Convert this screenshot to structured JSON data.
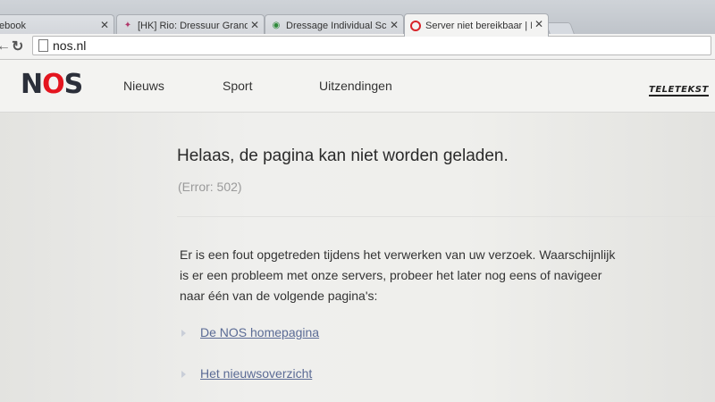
{
  "browser": {
    "tabs": [
      {
        "title": "ebook",
        "favicon": "facebook-icon",
        "active": false
      },
      {
        "title": "[HK] Rio: Dressuur Grand",
        "favicon": "rio-icon",
        "active": false
      },
      {
        "title": "Dressage Individual Sched",
        "favicon": "olympic-icon",
        "active": false
      },
      {
        "title": "Server niet bereikbaar | N",
        "favicon": "nos-icon",
        "active": true
      }
    ],
    "close_glyph": "✕",
    "address": "nos.nl"
  },
  "site": {
    "logo_prefix": "N",
    "logo_o": "O",
    "logo_suffix": "S",
    "nav": [
      "Nieuws",
      "Sport",
      "Uitzendingen"
    ],
    "teletekst": "TELETEKST"
  },
  "error": {
    "title": "Helaas, de pagina kan niet worden geladen.",
    "code": "(Error: 502)",
    "message_lines": [
      "Er is een fout opgetreden tijdens het verwerken van uw verzoek. Waarschijnlijk",
      "is er een probleem met onze servers, probeer het later nog eens of navigeer",
      "naar één van de volgende pagina's:"
    ],
    "links": [
      "De NOS homepagina",
      "Het nieuwsoverzicht"
    ]
  },
  "colors": {
    "nos_red": "#e4151f",
    "link": "#5b6b95"
  }
}
